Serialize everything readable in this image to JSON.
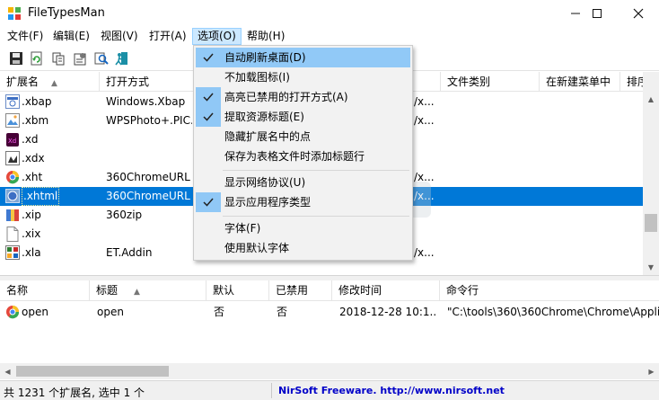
{
  "window": {
    "title": "FileTypesMan",
    "icon": "filetypesman-icon",
    "controls": [
      "minimize-icon",
      "maximize-icon",
      "close-icon"
    ]
  },
  "menu": {
    "items": [
      {
        "label": "文件(F)"
      },
      {
        "label": "编辑(E)"
      },
      {
        "label": "视图(V)"
      },
      {
        "label": "打开(A)"
      },
      {
        "label": "选项(O)",
        "active": true
      },
      {
        "label": "帮助(H)"
      }
    ]
  },
  "toolbar": {
    "buttons": [
      "save-icon",
      "refresh-icon",
      "copy-icon",
      "properties-icon",
      "find-icon",
      "exit-icon"
    ]
  },
  "file_list": {
    "columns": [
      "扩展名",
      "打开方式",
      "文件类别",
      "在新建菜单中",
      "排序"
    ],
    "rows": [
      {
        "ext": ".xbap",
        "open_with": "Windows.Xbap",
        "desc": "/x...",
        "icon": "xbap-file-icon"
      },
      {
        "ext": ".xbm",
        "open_with": "WPSPhoto+.PIC.x...",
        "desc": "/x...",
        "icon": "image-file-icon"
      },
      {
        "ext": ".xd",
        "open_with": "",
        "desc": "",
        "icon": "xd-file-icon"
      },
      {
        "ext": ".xdx",
        "open_with": "",
        "desc": "",
        "icon": "generic-file-icon"
      },
      {
        "ext": ".xht",
        "open_with": "360ChromeURL",
        "desc": "/x...",
        "icon": "browser-file-icon"
      },
      {
        "ext": ".xhtml",
        "open_with": "360ChromeURL",
        "desc": "/x...",
        "icon": "browser-file-icon",
        "selected": true
      },
      {
        "ext": ".xip",
        "open_with": "360zip",
        "desc": "",
        "icon": "zip-file-icon"
      },
      {
        "ext": ".xix",
        "open_with": "",
        "desc": "",
        "icon": "blank-file-icon"
      },
      {
        "ext": ".xla",
        "open_with": "ET.Addin",
        "desc": "/x...",
        "icon": "excel-addin-icon"
      }
    ]
  },
  "options_menu": {
    "items": [
      {
        "label": "自动刷新桌面(D)",
        "checked": true,
        "highlight": true
      },
      {
        "label": "不加载图标(I)",
        "checked": false
      },
      {
        "label": "高亮已禁用的打开方式(A)",
        "checked": true
      },
      {
        "label": "提取资源标题(E)",
        "checked": true
      },
      {
        "label": "隐藏扩展名中的点",
        "checked": false
      },
      {
        "label": "保存为表格文件时添加标题行",
        "checked": false
      },
      {
        "separator": true
      },
      {
        "label": "显示网络协议(U)",
        "checked": false
      },
      {
        "label": "显示应用程序类型",
        "checked": true
      },
      {
        "separator": true
      },
      {
        "label": "字体(F)",
        "checked": false
      },
      {
        "label": "使用默认字体",
        "checked": false
      }
    ]
  },
  "actions_list": {
    "columns": [
      "名称",
      "标题",
      "默认",
      "已禁用",
      "修改时间",
      "命令行"
    ],
    "rows": [
      {
        "name": "open",
        "title": "open",
        "default": "否",
        "disabled": "否",
        "modified": "2018-12-28 10:1...",
        "command": "\"C:\\tools\\360\\360Chrome\\Chrome\\Appli",
        "icon": "chrome-icon"
      }
    ]
  },
  "status": {
    "count_text": "共 1231 个扩展名, 选中 1 个",
    "link_text": "NirSoft Freeware.  http://www.nirsoft.net"
  },
  "colors": {
    "selection": "#0078d7",
    "menu_highlight": "#91c9f7",
    "link": "#0000c8"
  }
}
